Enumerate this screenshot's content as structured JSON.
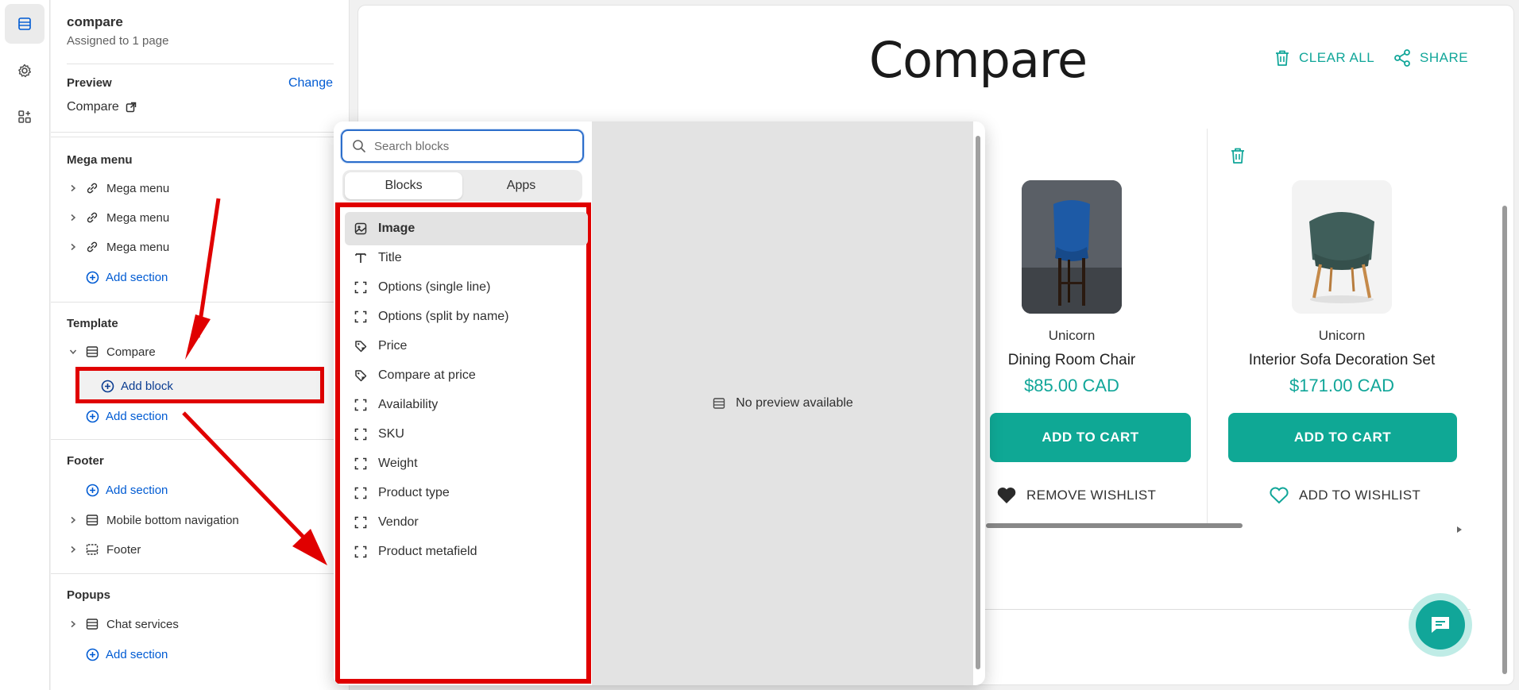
{
  "sidebar": {
    "template_name": "compare",
    "assigned": "Assigned to 1 page",
    "preview_label": "Preview",
    "preview_change": "Change",
    "preview_page": "Compare",
    "mega_menu": {
      "heading": "Mega menu",
      "items": [
        "Mega menu",
        "Mega menu",
        "Mega menu"
      ],
      "add_section": "Add section"
    },
    "template": {
      "heading": "Template",
      "section": "Compare",
      "add_block": "Add block",
      "add_section": "Add section"
    },
    "footer": {
      "heading": "Footer",
      "add_section": "Add section",
      "items": [
        "Mobile bottom navigation",
        "Footer"
      ]
    },
    "popups": {
      "heading": "Popups",
      "items": [
        "Chat services"
      ],
      "add_section": "Add section"
    }
  },
  "picker": {
    "search_placeholder": "Search blocks",
    "tabs": [
      "Blocks",
      "Apps"
    ],
    "active_tab": "Blocks",
    "blocks": [
      {
        "label": "Image",
        "icon": "image-icon",
        "selected": true
      },
      {
        "label": "Title",
        "icon": "text-icon"
      },
      {
        "label": "Options (single line)",
        "icon": "dashed-square-icon"
      },
      {
        "label": "Options (split by name)",
        "icon": "dashed-square-icon"
      },
      {
        "label": "Price",
        "icon": "price-tag-icon"
      },
      {
        "label": "Compare at price",
        "icon": "price-tag-icon"
      },
      {
        "label": "Availability",
        "icon": "dashed-square-icon"
      },
      {
        "label": "SKU",
        "icon": "dashed-square-icon"
      },
      {
        "label": "Weight",
        "icon": "dashed-square-icon"
      },
      {
        "label": "Product type",
        "icon": "dashed-square-icon"
      },
      {
        "label": "Vendor",
        "icon": "dashed-square-icon"
      },
      {
        "label": "Product metafield",
        "icon": "dashed-square-icon"
      }
    ],
    "no_preview": "No preview available"
  },
  "store": {
    "title": "Compare",
    "clear_all": "CLEAR ALL",
    "share": "SHARE",
    "products": [
      {
        "vendor": "Unicorn",
        "name": "Dining Room Chair",
        "price": "$85.00 CAD",
        "cart": "ADD TO CART",
        "wishlist": "REMOVE WISHLIST"
      },
      {
        "vendor": "Unicorn",
        "name": "Interior Sofa Decoration Set",
        "price": "$171.00 CAD",
        "cart": "ADD TO CART",
        "wishlist": "ADD TO WISHLIST"
      }
    ]
  },
  "colors": {
    "accent": "#11a699",
    "link": "#005bd3",
    "highlight": "#e00000"
  }
}
